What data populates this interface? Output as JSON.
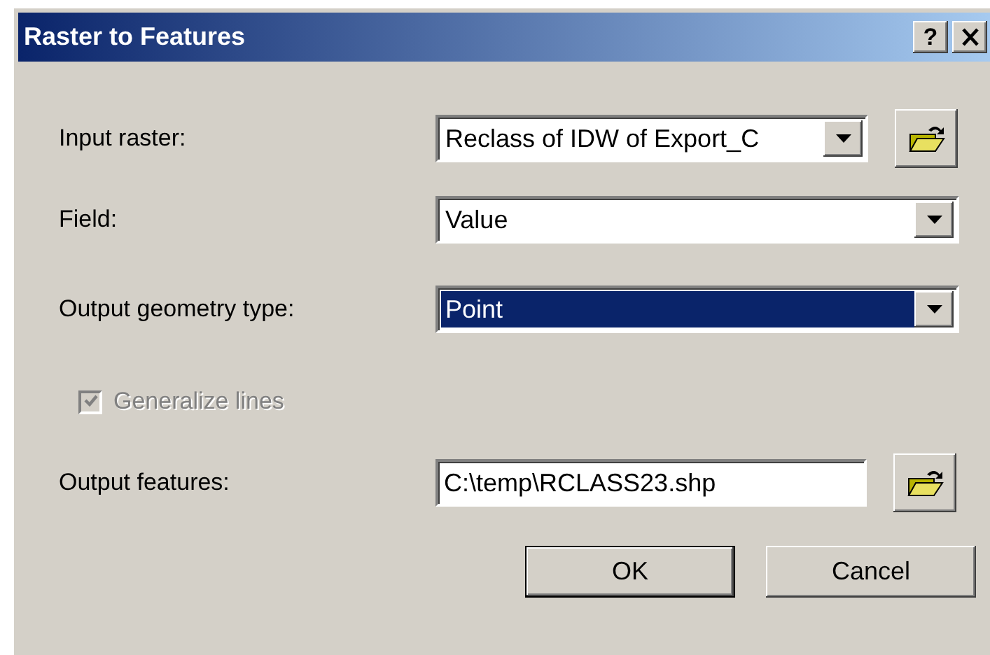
{
  "window": {
    "title": "Raster to Features",
    "help_label": "?"
  },
  "fields": [
    {
      "kind": "combo",
      "label": "Input raster:",
      "value": "Reclass of IDW of Export_C",
      "browse": true,
      "focused": false
    },
    {
      "kind": "combo",
      "label": "Field:",
      "value": "Value",
      "browse": false,
      "focused": false
    },
    {
      "kind": "combo",
      "label": "Output geometry type:",
      "value": "Point",
      "browse": false,
      "focused": true
    },
    {
      "kind": "checkbox",
      "label": "Generalize lines",
      "checked": true,
      "disabled": true
    },
    {
      "kind": "text",
      "label": "Output features:",
      "value": "C:\\temp\\RCLASS23.shp",
      "browse": true
    }
  ],
  "buttons": [
    {
      "label": "OK",
      "default": true
    },
    {
      "label": "Cancel",
      "default": false
    }
  ]
}
